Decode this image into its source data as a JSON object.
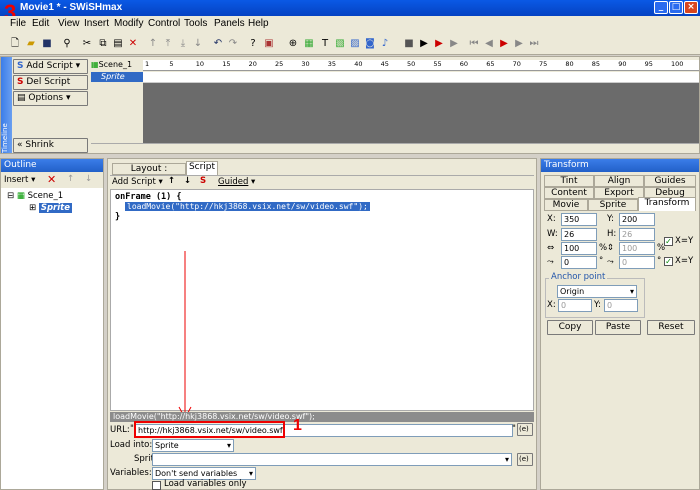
{
  "window": {
    "title": "Movie1 * - SWiSHmax",
    "annotation_number": "3"
  },
  "menu": [
    "File",
    "Edit",
    "View",
    "Insert",
    "Modify",
    "Control",
    "Tools",
    "Panels",
    "Help"
  ],
  "timeline": {
    "add_script": "Add Script",
    "del_script": "Del Script",
    "options": "Options",
    "shrink": "Shrink",
    "scene_label": "Scene_1",
    "sprite_label": "Sprite",
    "vertical_label": "Timeline",
    "ruler": [
      "1",
      "5",
      "10",
      "15",
      "20",
      "25",
      "30",
      "35",
      "40",
      "45",
      "50",
      "55",
      "60",
      "65",
      "70",
      "75",
      "80",
      "85",
      "90",
      "95",
      "100"
    ]
  },
  "outline": {
    "title": "Outline",
    "insert": "Insert",
    "scene": "Scene_1",
    "sprite": "Sprite"
  },
  "script_panel": {
    "tabs": [
      "Layout : Scene_1",
      "Script"
    ],
    "add_script": "Add Script",
    "guided": "Guided",
    "code": [
      "onFrame (1) {",
      "loadMovie(\"http://hkj3868.vsix.net/sw/video.swf\");",
      "}"
    ],
    "status_line": "loadMovie(\"http://hkj3868.vsix.net/sw/video.swf\");",
    "url_label": "URL:",
    "url_value": "http://hkj3868.vsix.net/sw/video.swf",
    "quote": "\"",
    "expr_btn": "(e)",
    "load_into_label": "Load into:",
    "load_into_value": "Sprite",
    "sprite_label": "Sprite:",
    "variables_label": "Variables:",
    "variables_value": "Don't send variables",
    "load_vars_only": "Load variables only",
    "annotation_number": "1"
  },
  "transform": {
    "title": "Transform",
    "tabs_row1": [
      "Tint",
      "Align",
      "Guides"
    ],
    "tabs_row2": [
      "Content",
      "Export",
      "Debug"
    ],
    "tabs_row3": [
      "Movie",
      "Sprite",
      "Transform"
    ],
    "x_label": "X:",
    "x": "350",
    "y_label": "Y:",
    "y": "200",
    "w_label": "W:",
    "w": "26",
    "h_label": "H:",
    "h": "26",
    "scale_x": "100",
    "scale_y": "100",
    "pct": "%",
    "rot1": "0",
    "rot2": "0",
    "deg": "°",
    "xy1": "X=Y",
    "xy2": "X=Y",
    "anchor_label": "Anchor point",
    "anchor_value": "Origin",
    "ax_label": "X:",
    "ax": "0",
    "ay_label": "Y:",
    "ay": "0",
    "copy": "Copy",
    "paste": "Paste",
    "reset": "Reset"
  },
  "colors": {
    "title_bg": "#0a59e5",
    "panel": "#ece9d8",
    "highlight": "#316ac5",
    "annotation": "#e00000"
  }
}
